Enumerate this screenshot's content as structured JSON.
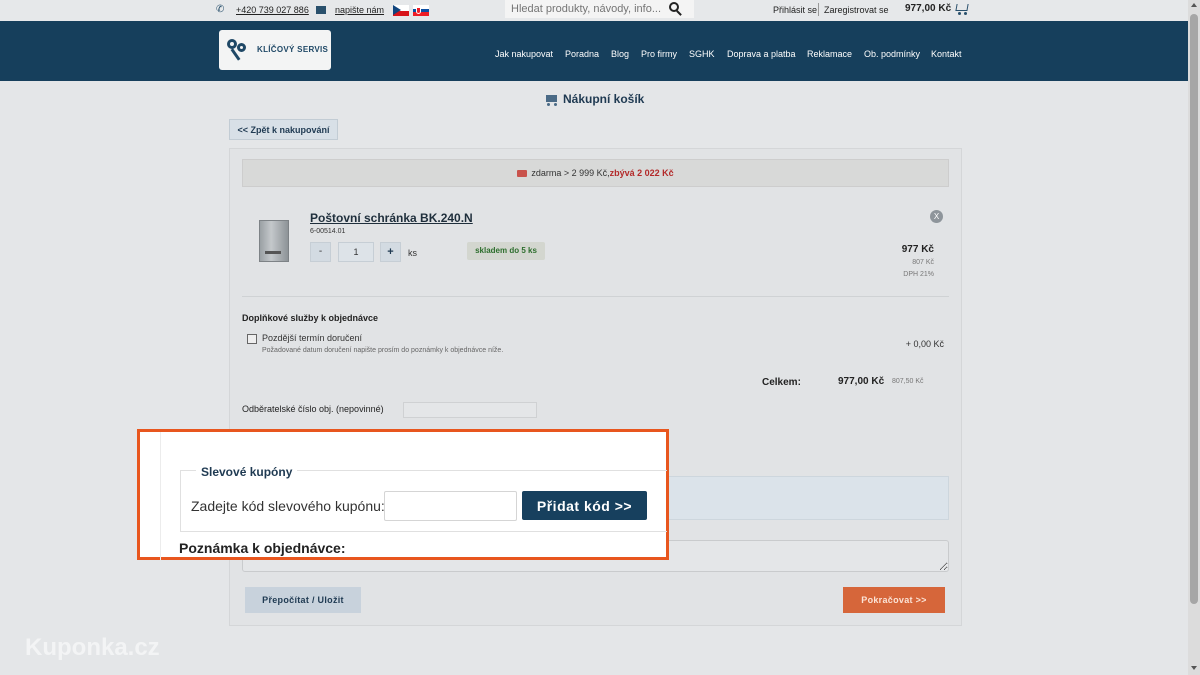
{
  "topbar": {
    "phone": "+420 739 027 886",
    "email_link": "napište nám",
    "search_placeholder": "Hledat produkty, návody, info...",
    "login": "Přihlásit se",
    "register": "Zaregistrovat se",
    "cart_total": "977,00 Kč"
  },
  "header": {
    "logo_text": "KLÍČOVÝ SERVIS",
    "nav": [
      "Jak nakupovat",
      "Poradna",
      "Blog",
      "Pro firmy",
      "SGHK",
      "Doprava a platba",
      "Reklamace",
      "Ob. podmínky",
      "Kontakt"
    ]
  },
  "page": {
    "title": "Nákupní košík",
    "back_button": "<< Zpět k nakupování"
  },
  "shipping": {
    "text": "zdarma > 2 999 Kč,",
    "remaining": "zbývá 2 022 Kč"
  },
  "product": {
    "name": "Poštovní schránka BK.240.N",
    "code": "6-00514.01",
    "qty": "1",
    "minus": "-",
    "plus": "+",
    "unit": "ks",
    "stock": "skladem do 5 ks",
    "remove": "X",
    "price": "977 Kč",
    "price_net": "807 Kč",
    "vat": "DPH 21%"
  },
  "services": {
    "title": "Doplňkové služby k objednávce",
    "later_label": "Pozdější termín doručení",
    "later_note": "Požadované datum doručení napište prosím do poznámky k objednávce níže.",
    "later_price": "+ 0,00 Kč"
  },
  "total": {
    "label": "Celkem:",
    "value": "977,00 Kč",
    "net": "807,50 Kč"
  },
  "order_number": {
    "label": "Odběratelské číslo obj. (nepovinné)"
  },
  "coupon": {
    "legend": "Slevové kupóny",
    "label": "Zadejte kód slevového kupónu:",
    "button": "Přidat kód >>",
    "note_heading": "Poznámka k objednávce:"
  },
  "actions": {
    "recalc": "Přepočítat / Uložit",
    "continue": "Pokračovat >>"
  },
  "watermark": "Kuponka.cz",
  "colors": {
    "header_bg": "#163f5c",
    "highlight_border": "#e8561e",
    "continue_button": "#d6663a",
    "coupon_button": "#17405e"
  }
}
